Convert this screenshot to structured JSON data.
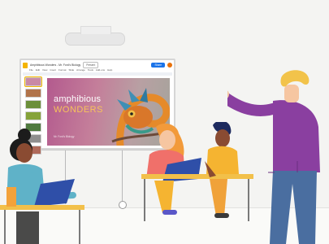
{
  "slides_app": {
    "doc_title": "Amphibious Wonders - Mr. Ford's Biology",
    "menu": [
      "File",
      "Edit",
      "View",
      "Insert",
      "Format",
      "Slide",
      "Arrange",
      "Tools",
      "Add-ons",
      "Help"
    ],
    "present_label": "Present",
    "share_label": "Share"
  },
  "slide": {
    "title_line_1": "amphibious",
    "title_line_2": "WONDERS",
    "subtitle": "Mr. Ford's Biology"
  },
  "thumbnails": [
    {
      "color": "#c98aa6"
    },
    {
      "color": "#b1734a"
    },
    {
      "color": "#6b8f3a"
    },
    {
      "color": "#86a33a"
    },
    {
      "color": "#4f7a3f"
    },
    {
      "color": "#8f8f8f"
    },
    {
      "color": "#b06a5a"
    }
  ],
  "colors": {
    "slides_yellow": "#f4b400",
    "share_blue": "#1a73e8",
    "teacher_shirt": "#8a3fa0",
    "student_pink": "#f0706a",
    "student_yellow": "#f5b431"
  }
}
